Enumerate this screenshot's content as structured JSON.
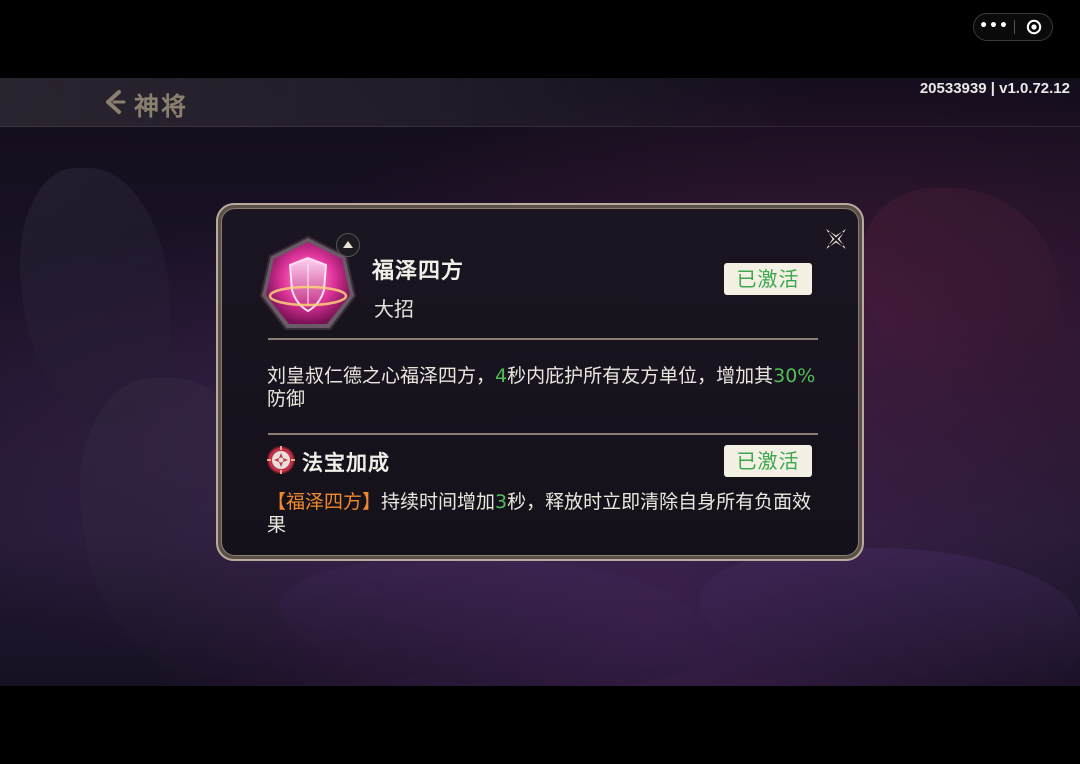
{
  "nav": {
    "title": "神将"
  },
  "version": "20533939 | v1.0.72.12",
  "capsule": {
    "more_label": "•••"
  },
  "dialog": {
    "skill_name": "福泽四方",
    "skill_type": "大招",
    "status": "已激活",
    "description": {
      "part1": "刘皇叔仁德之心福泽四方，",
      "duration": "4",
      "part2": "秒内庇护所有友方单位，增加其",
      "percent": "30%",
      "part3": "防御"
    },
    "bonus": {
      "title": "法宝加成",
      "status": "已激活",
      "description": {
        "skill_ref": "【福泽四方】",
        "part1": "持续时间增加",
        "extra_seconds": "3",
        "part2": "秒，释放时立即清除自身所有负面效果"
      }
    }
  },
  "colors": {
    "accent_green": "#4fbf5a",
    "accent_orange": "#f0892c",
    "skill_icon": "#e0359b"
  },
  "icons": {
    "back": "chevron-left-icon",
    "close": "close-x-icon",
    "skill": "shield-icon",
    "bonus": "treasure-icon",
    "capsule_close": "target-circle-icon"
  }
}
